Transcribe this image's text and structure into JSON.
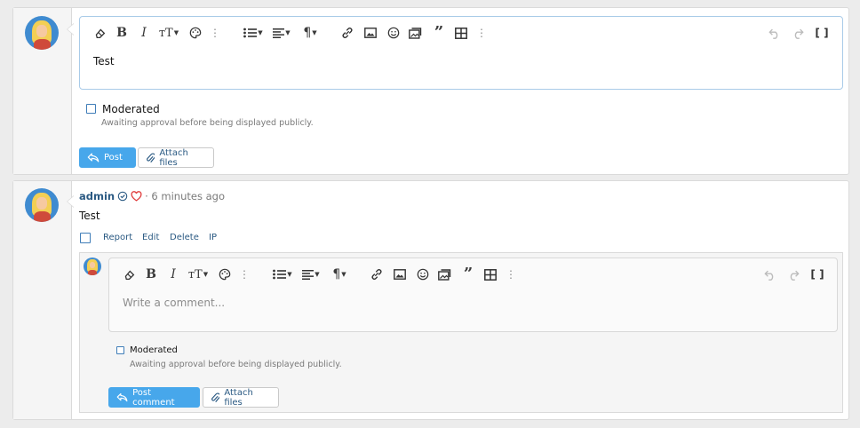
{
  "reply_form": {
    "editor_text": "Test",
    "moderated_label": "Moderated",
    "moderated_hint": "Awaiting approval before being displayed publicly.",
    "post_label": "Post",
    "attach_label": "Attach files"
  },
  "message": {
    "author": "admin",
    "time": "· 6 minutes ago",
    "body": "Test",
    "actions": [
      "Report",
      "Edit",
      "Delete",
      "IP"
    ]
  },
  "comment_form": {
    "placeholder": "Write a comment...",
    "moderated_label": "Moderated",
    "moderated_hint": "Awaiting approval before being displayed publicly.",
    "post_label": "Post comment",
    "attach_label": "Attach files"
  },
  "toolbar_icons": [
    "eraser-icon",
    "bold-icon",
    "italic-icon",
    "font-size-icon",
    "palette-icon",
    "more-vertical-icon",
    "list-icon",
    "align-icon",
    "paragraph-icon",
    "link-icon",
    "image-icon",
    "smiley-icon",
    "media-icon",
    "quote-icon",
    "table-icon",
    "more-vertical-icon",
    "undo-icon",
    "redo-icon",
    "toggle-bbcode-icon"
  ],
  "colors": {
    "accent": "#47a7eb",
    "link": "#2b5a83",
    "editor_border": "#a9cbe8",
    "like_heart": "#e03b3b"
  }
}
